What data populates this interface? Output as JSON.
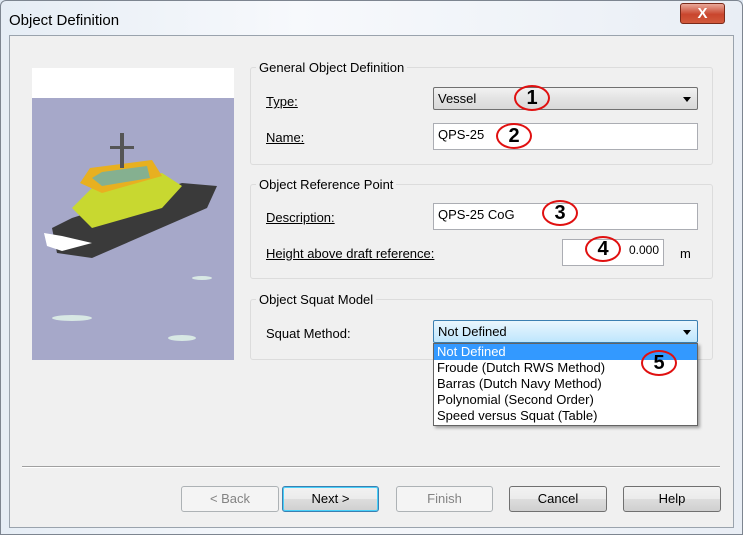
{
  "window": {
    "title": "Object Definition",
    "close_label": "X"
  },
  "general": {
    "title": "General Object Definition",
    "type_label": "Type:",
    "type_value": "Vessel",
    "name_label": "Name:",
    "name_value": "QPS-25"
  },
  "reference": {
    "title": "Object Reference Point",
    "description_label": "Description:",
    "description_value": "QPS-25 CoG",
    "height_label": "Height above draft reference:",
    "height_value": "0.000",
    "height_unit": "m"
  },
  "squat": {
    "title": "Object Squat Model",
    "method_label": "Squat Method:",
    "method_value": "Not Defined",
    "options": [
      "Not Defined",
      "Froude (Dutch RWS Method)",
      "Barras (Dutch Navy Method)",
      "Polynomial (Second Order)",
      "Speed versus Squat (Table)"
    ]
  },
  "buttons": {
    "back": "< Back",
    "next": "Next >",
    "finish": "Finish",
    "cancel": "Cancel",
    "help": "Help"
  },
  "annotations": [
    "1",
    "2",
    "3",
    "4",
    "5"
  ]
}
